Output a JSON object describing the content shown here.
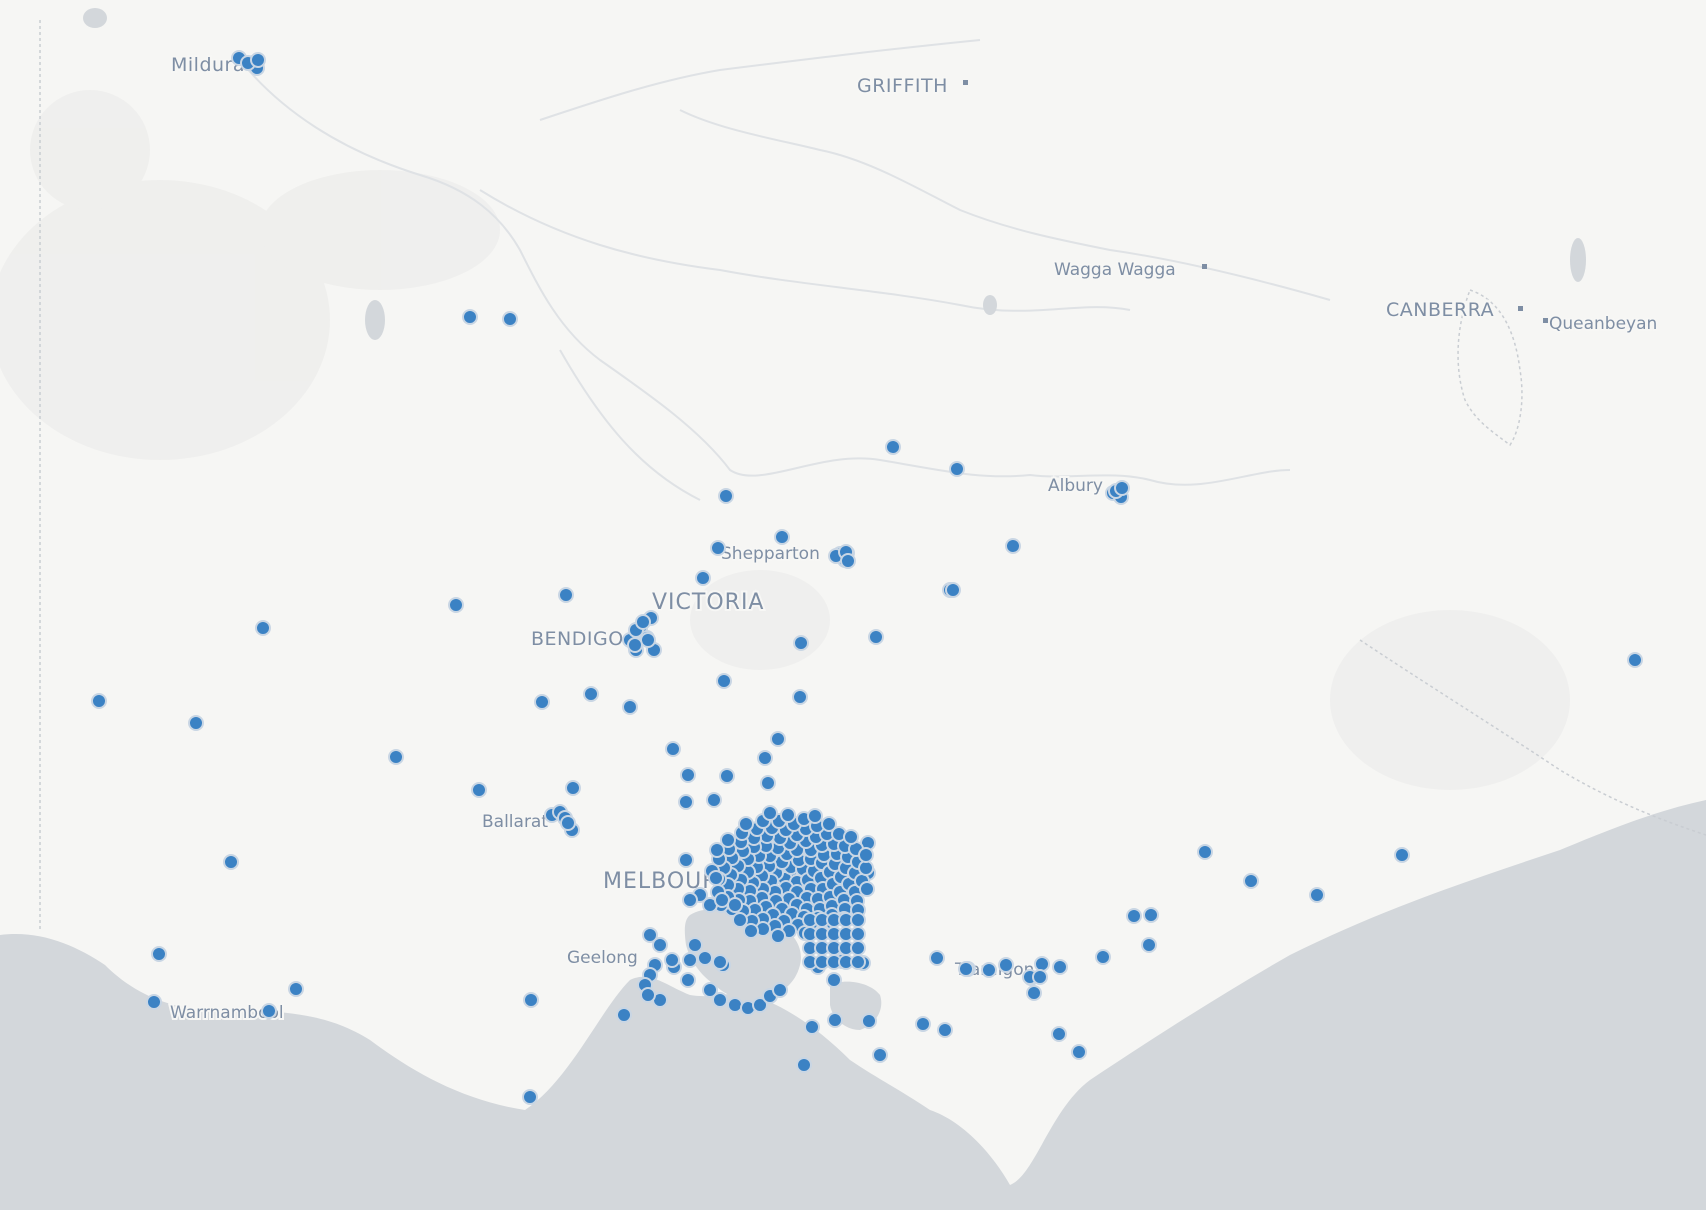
{
  "map": {
    "labels": {
      "mildura": "Mildura",
      "griffith": "GRIFFITH",
      "wagga_wagga": "Wagga Wagga",
      "canberra": "CANBERRA",
      "queanbeyan": "Queanbeyan",
      "albury": "Albury",
      "shepparton": "Shepparton",
      "victoria": "VICTORIA",
      "bendigo": "BENDIGO",
      "ballarat": "Ballarat",
      "melbourne": "MELBOURNE",
      "geelong": "Geelong",
      "warrnambool": "Warrnambool",
      "traralgon": "Traralgon"
    },
    "colors": {
      "land": "#f6f6f4",
      "sea": "#d3d7db",
      "marker": "#3b82c4",
      "label": "#7e8ea4"
    }
  }
}
